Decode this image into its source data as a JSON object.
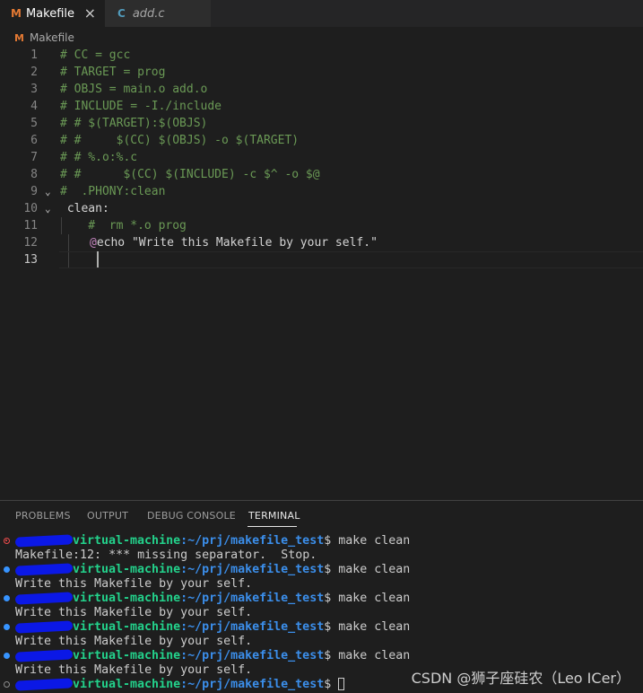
{
  "tabs": [
    {
      "icon": "makefile-icon",
      "icon_glyph": "M",
      "label": "Makefile",
      "close": "×",
      "active": true
    },
    {
      "icon": "c-file-icon",
      "icon_glyph": "C",
      "label": "add.c",
      "active": false
    }
  ],
  "breadcrumb": {
    "icon_glyph": "M",
    "label": "Makefile"
  },
  "editor": {
    "lines": [
      {
        "n": "1",
        "text": "# CC = gcc"
      },
      {
        "n": "2",
        "text": "# TARGET = prog"
      },
      {
        "n": "3",
        "text": "# OBJS = main.o add.o"
      },
      {
        "n": "4",
        "text": "# INCLUDE = -I./include"
      },
      {
        "n": "5",
        "text": "# # $(TARGET):$(OBJS)"
      },
      {
        "n": "6",
        "text": "# #     $(CC) $(OBJS) -o $(TARGET)"
      },
      {
        "n": "7",
        "text": "# # %.o:%.c"
      },
      {
        "n": "8",
        "text": "# #      $(CC) $(INCLUDE) -c $^ -o $@"
      },
      {
        "n": "9",
        "text": "#  .PHONY:clean"
      },
      {
        "n": "10",
        "text": " clean:"
      },
      {
        "n": "11",
        "text": "    #  rm *.o prog"
      },
      {
        "n": "12",
        "decor": "@",
        "text": "echo \"Write this Makefile by your self.\""
      },
      {
        "n": "13",
        "text": ""
      }
    ],
    "fold_markers": {
      "line9": "⌄",
      "line10": "⌄"
    }
  },
  "panel": {
    "tabs": [
      "PROBLEMS",
      "OUTPUT",
      "DEBUG CONSOLE",
      "TERMINAL"
    ],
    "active_tab": "TERMINAL"
  },
  "terminal": {
    "host_suffix": "virtual-machine",
    "path": ":~/prj/makefile_test",
    "prompt_end": "$ ",
    "command": "make clean",
    "error_output": "Makefile:12: *** missing separator.  Stop.",
    "echo_output": "Write this Makefile by your self."
  },
  "watermark": "CSDN @狮子座硅农（Leo ICer）",
  "colors": {
    "accent_blue": "#3794ff",
    "error_red": "#f14c4c",
    "prompt_green": "#23d18b",
    "path_blue": "#3b8eea",
    "comment_green": "#6a9955"
  }
}
